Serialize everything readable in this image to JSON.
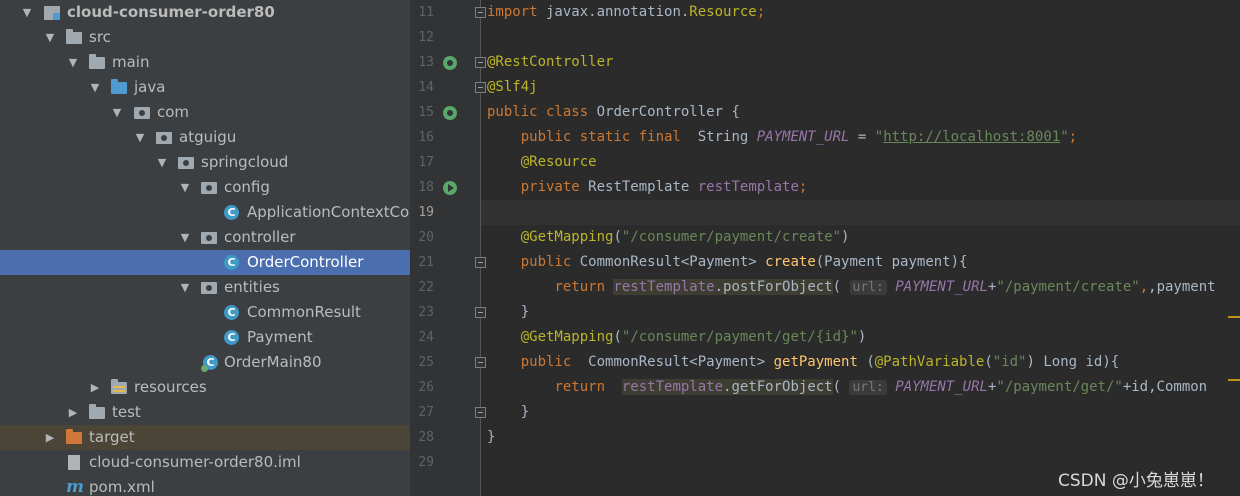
{
  "project_tree": {
    "nodes": [
      {
        "label": "cloud-consumer-order80",
        "expanded": true,
        "icon": "module-icon"
      },
      {
        "label": "src",
        "expanded": true,
        "icon": "folder-icon"
      },
      {
        "label": "main",
        "expanded": true,
        "icon": "folder-icon"
      },
      {
        "label": "java",
        "expanded": true,
        "icon": "source-folder-icon"
      },
      {
        "label": "com",
        "expanded": true,
        "icon": "package-icon"
      },
      {
        "label": "atguigu",
        "expanded": true,
        "icon": "package-icon"
      },
      {
        "label": "springcloud",
        "expanded": true,
        "icon": "package-icon"
      },
      {
        "label": "config",
        "expanded": true,
        "icon": "package-icon"
      },
      {
        "label": "ApplicationContextCo",
        "icon": "class-icon"
      },
      {
        "label": "controller",
        "expanded": true,
        "icon": "package-icon"
      },
      {
        "label": "OrderController",
        "icon": "class-icon",
        "selected": true
      },
      {
        "label": "entities",
        "expanded": true,
        "icon": "package-icon"
      },
      {
        "label": "CommonResult",
        "icon": "class-icon"
      },
      {
        "label": "Payment",
        "icon": "class-icon"
      },
      {
        "label": "OrderMain80",
        "icon": "spring-boot-main-class-icon"
      },
      {
        "label": "resources",
        "expanded": false,
        "icon": "resources-folder-icon"
      },
      {
        "label": "test",
        "expanded": false,
        "icon": "folder-icon"
      },
      {
        "label": "target",
        "expanded": false,
        "icon": "excluded-folder-icon"
      },
      {
        "label": "cloud-consumer-order80.iml",
        "icon": "iml-file-icon"
      },
      {
        "label": "pom.xml",
        "icon": "maven-icon"
      }
    ],
    "colors": {
      "background": "#3c3f41",
      "selected": "#4b6eaf",
      "excluded_row": "#4a4536"
    }
  },
  "editor": {
    "current_line": "19",
    "line_numbers": [
      "11",
      "12",
      "13",
      "14",
      "15",
      "16",
      "17",
      "18",
      "19",
      "20",
      "21",
      "22",
      "23",
      "24",
      "25",
      "26",
      "27",
      "28",
      "29"
    ],
    "code": {
      "l11": {
        "kw": "import",
        "text": " javax.annotation.",
        "ann": "Resource",
        "end": ";"
      },
      "l13": {
        "ann": "@RestController"
      },
      "l14": {
        "ann": "@Slf4j"
      },
      "l15": {
        "kw": "public class",
        "text": " OrderController {"
      },
      "l16": {
        "kw": "public static final",
        "text": "  String ",
        "field": "PAYMENT_URL",
        "eq": " = ",
        "q1": "\"",
        "url": "http://localhost:8001",
        "q2": "\"",
        "end": ";"
      },
      "l17": {
        "ann": "@Resource"
      },
      "l18": {
        "kw": "private",
        "text": " RestTemplate ",
        "field": "restTemplate",
        "end": ";"
      },
      "l20": {
        "ann": "@GetMapping",
        "open": "(",
        "str": "\"/consumer/payment/create\"",
        "close": ")"
      },
      "l21": {
        "kw": "public",
        "type": " CommonResult<Payment> ",
        "method": "create",
        "params": "(Payment payment){"
      },
      "l22": {
        "kw": "return",
        "obj": "restTemplate",
        "call": ".postForObject",
        "paren": "(",
        "hint": "url:",
        "field": "PAYMENT_URL",
        "plus": "+",
        "str": "\"/payment/create\"",
        "rest": ",payment"
      },
      "l23": {
        "text": "}"
      },
      "l24": {
        "ann": "@GetMapping",
        "open": "(",
        "str": "\"/consumer/payment/get/{id}\"",
        "close": ")"
      },
      "l25": {
        "kw": "public",
        "type": "  CommonResult<Payment> ",
        "method": "getPayment",
        "sp": " (",
        "ann": "@PathVariable",
        "open": "(",
        "str": "\"id\"",
        "rest": ") Long id){"
      },
      "l26": {
        "kw": "return",
        "obj": "restTemplate",
        "call": ".getForObject",
        "paren": "(",
        "hint": "url:",
        "field": "PAYMENT_URL",
        "plus": "+",
        "str": "\"/payment/get/\"",
        "rest": "+id,Common"
      },
      "l27": {
        "text": "}"
      },
      "l28": {
        "text": "}"
      }
    },
    "colors": {
      "background": "#2b2b2b",
      "gutter": "#313335",
      "keyword": "#cc7832",
      "annotation": "#bbb529",
      "string": "#6a8759",
      "field": "#9876aa",
      "method": "#ffc66d",
      "text": "#a9b7c6"
    },
    "gutter_icons": [
      {
        "line": "13",
        "icon": "spring-bean-icon"
      },
      {
        "line": "15",
        "icon": "spring-bean-icon"
      },
      {
        "line": "18",
        "icon": "navigate-to-bean-icon"
      }
    ]
  },
  "watermark": "CSDN @小兔崽崽！"
}
